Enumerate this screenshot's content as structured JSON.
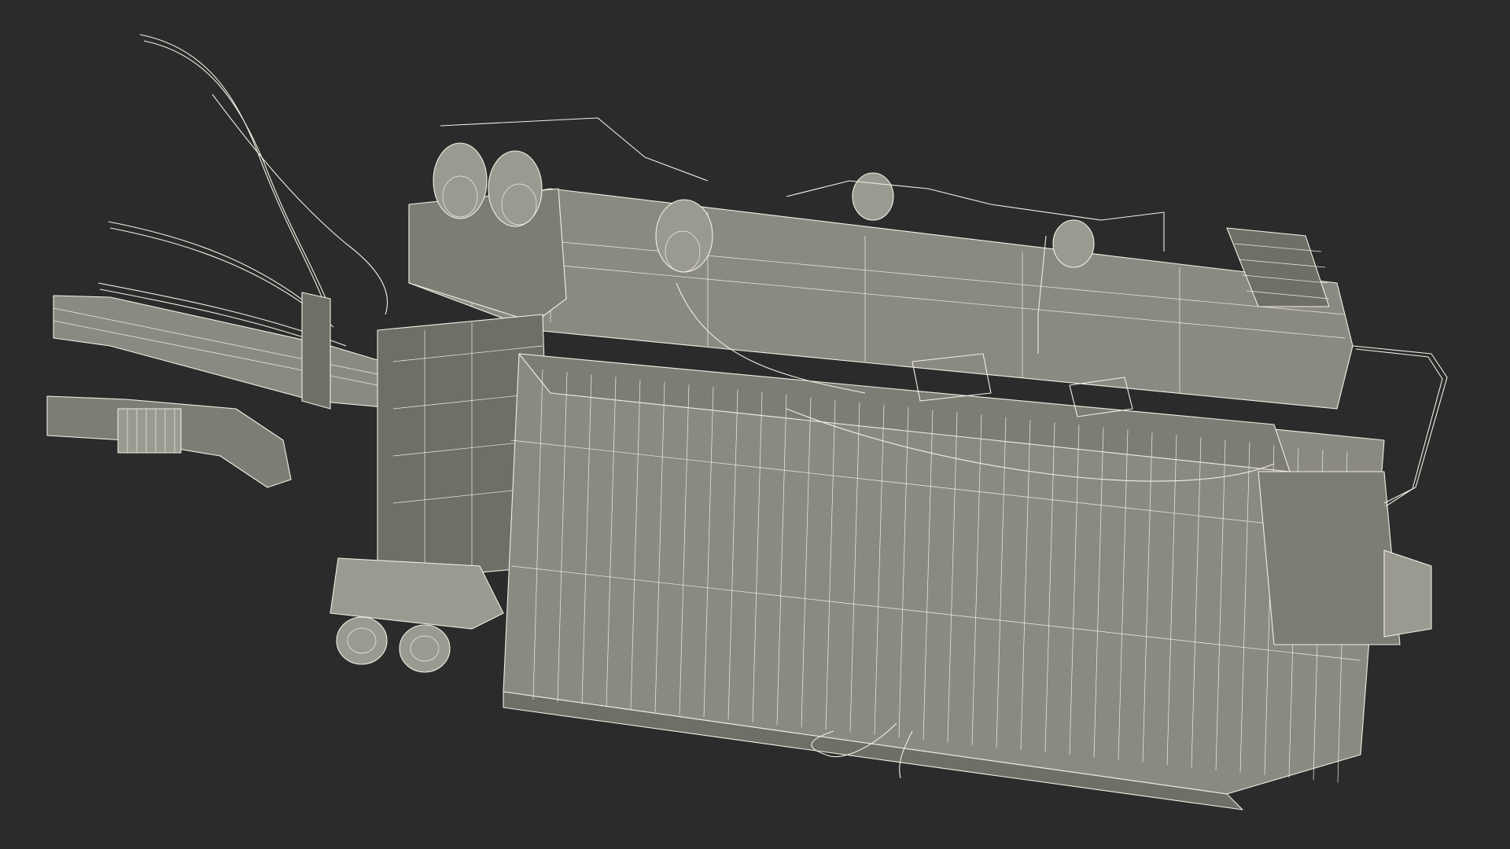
{
  "scene": {
    "background_color": "#2b2b2b",
    "wire_color": "#f1efe3",
    "surface_color": "#8a8a82"
  }
}
